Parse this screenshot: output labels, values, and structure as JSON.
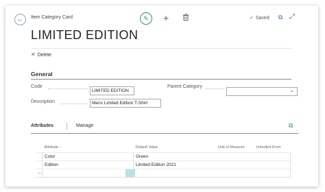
{
  "header": {
    "page_type": "Item Category Card",
    "saved_label": "Saved",
    "title": "LIMITED EDITION"
  },
  "actions": {
    "delete_label": "Delete"
  },
  "general": {
    "section_title": "General",
    "code_label": "Code",
    "code_value": "LIMITED EDITION",
    "description_label": "Description",
    "description_value": "Mens Limited Edition T-Shirt",
    "parent_label": "Parent Category",
    "parent_value": ""
  },
  "attributes": {
    "tab_label": "Attributes",
    "manage_label": "Manage",
    "columns": [
      "Attribute ↑",
      "Default Value",
      "Unit of Measure",
      "Inherited From"
    ],
    "rows": [
      {
        "attribute": "Color",
        "default_value": "Green",
        "unit": "",
        "inherited": ""
      },
      {
        "attribute": "Edition",
        "default_value": "Limited Edition 2021",
        "unit": "",
        "inherited": ""
      }
    ],
    "new_row_marker": "→"
  },
  "icons": {
    "back": "back-arrow-icon",
    "edit": "pencil-icon",
    "new": "plus-icon",
    "delete": "trash-icon",
    "saved": "check-icon",
    "open_new_window": "open-in-new-window-icon",
    "expand": "expand-icon",
    "delete_action": "x-icon",
    "dropdown": "chevron-down-icon"
  },
  "colors": {
    "accent": "#2f8a7a",
    "link": "#3a6d98",
    "selected_cell": "#b3e3e6"
  }
}
